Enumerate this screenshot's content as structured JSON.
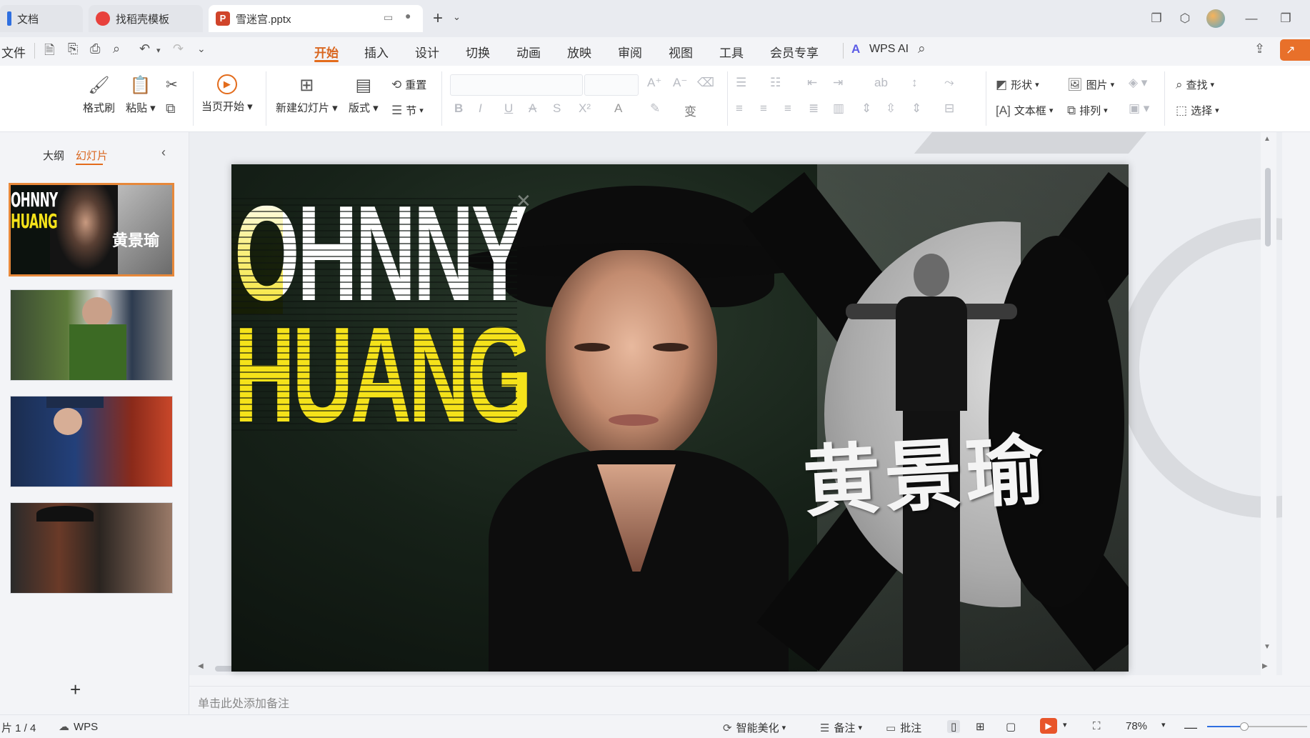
{
  "tabs": [
    {
      "label": "文档"
    },
    {
      "label": "找稻壳模板"
    },
    {
      "label": "雪迷宫.pptx"
    }
  ],
  "menu": {
    "file": "文件",
    "items": [
      "开始",
      "插入",
      "设计",
      "切换",
      "动画",
      "放映",
      "审阅",
      "视图",
      "工具",
      "会员专享"
    ],
    "active": "开始",
    "wps_ai": "WPS AI"
  },
  "ribbon": {
    "format_painter": "格式刷",
    "paste": "粘贴",
    "start_from_current": "当页开始",
    "new_slide": "新建幻灯片",
    "layout": "版式",
    "reset": "重置",
    "section": "节",
    "shape": "形状",
    "picture": "图片",
    "textbox": "文本框",
    "arrange": "排列",
    "find": "查找",
    "select": "选择"
  },
  "left_panel": {
    "outline_tab": "大纲",
    "slides_tab": "幻灯片",
    "add_slide": "+",
    "selected_index": 1,
    "slide_count": 4
  },
  "slide": {
    "title_line1": "OHNNY",
    "title_line2": "HUANG",
    "chinese_name": "黄景瑜"
  },
  "notes_placeholder": "单击此处添加备注",
  "status": {
    "slide_indicator": "片 1 / 4",
    "wps_label": "WPS",
    "smart_beautify": "智能美化",
    "notes_button": "备注",
    "comment_button": "批注",
    "zoom": "78%"
  },
  "colors": {
    "accent": "#e36c1c",
    "title_yellow": "#f5e21a",
    "ribbon_bg": "#ffffff",
    "app_bg": "#f3f4f7"
  }
}
